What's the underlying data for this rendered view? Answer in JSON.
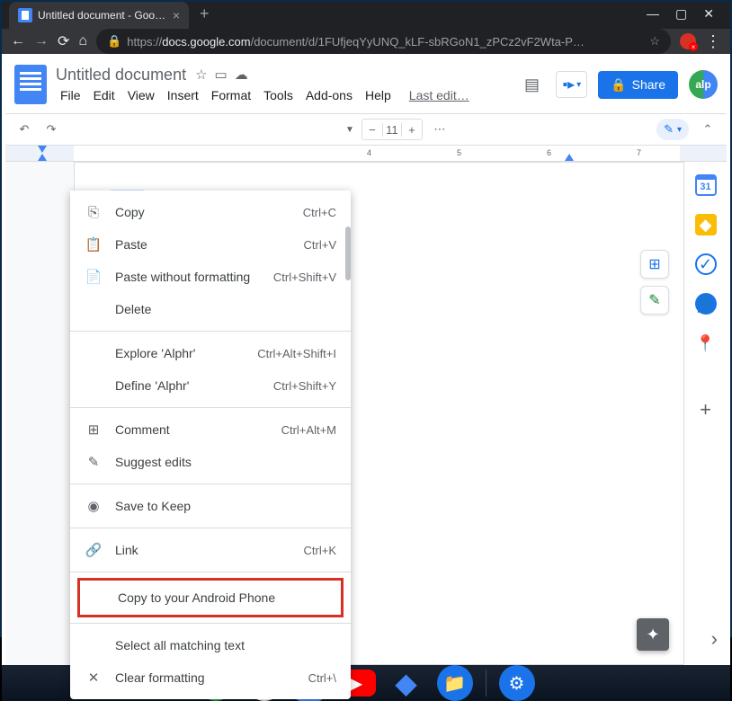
{
  "browser": {
    "tab_title": "Untitled document - Google Doc",
    "url_prefix": "https://",
    "url_domain": "docs.google.com",
    "url_path": "/document/d/1FUfjeqYyUNQ_kLF-sbRGoN1_zPCz2vF2Wta-P…"
  },
  "docs": {
    "title": "Untitled document",
    "menubar": [
      "File",
      "Edit",
      "View",
      "Insert",
      "Format",
      "Tools",
      "Add-ons",
      "Help"
    ],
    "last_edit": "Last edit…",
    "share_label": "Share",
    "avatar": "alp",
    "font_size": "11",
    "selected_text": "Alphr"
  },
  "ruler_ticks": [
    {
      "pos": 402,
      "label": "4"
    },
    {
      "pos": 502,
      "label": "5"
    },
    {
      "pos": 602,
      "label": "6"
    },
    {
      "pos": 702,
      "label": "7"
    }
  ],
  "context_menu": [
    {
      "type": "item",
      "icon": "⎘",
      "label": "Copy",
      "shortcut": "Ctrl+C"
    },
    {
      "type": "item",
      "icon": "📋",
      "label": "Paste",
      "shortcut": "Ctrl+V"
    },
    {
      "type": "item",
      "icon": "📄",
      "label": "Paste without formatting",
      "shortcut": "Ctrl+Shift+V"
    },
    {
      "type": "item",
      "icon": "",
      "label": "Delete",
      "shortcut": ""
    },
    {
      "type": "sep"
    },
    {
      "type": "item",
      "icon": "",
      "label": "Explore 'Alphr'",
      "shortcut": "Ctrl+Alt+Shift+I"
    },
    {
      "type": "item",
      "icon": "",
      "label": "Define 'Alphr'",
      "shortcut": "Ctrl+Shift+Y"
    },
    {
      "type": "sep"
    },
    {
      "type": "item",
      "icon": "⊞",
      "label": "Comment",
      "shortcut": "Ctrl+Alt+M"
    },
    {
      "type": "item",
      "icon": "✎",
      "label": "Suggest edits",
      "shortcut": ""
    },
    {
      "type": "sep"
    },
    {
      "type": "item",
      "icon": "◉",
      "label": "Save to Keep",
      "shortcut": ""
    },
    {
      "type": "sep"
    },
    {
      "type": "item",
      "icon": "🔗",
      "label": "Link",
      "shortcut": "Ctrl+K"
    },
    {
      "type": "sep"
    },
    {
      "type": "item",
      "icon": "",
      "label": "Copy to your Android Phone",
      "shortcut": "",
      "boxed": true
    },
    {
      "type": "sep"
    },
    {
      "type": "item",
      "icon": "",
      "label": "Select all matching text",
      "shortcut": ""
    },
    {
      "type": "item",
      "icon": "✕",
      "label": "Clear formatting",
      "shortcut": "Ctrl+\\"
    }
  ],
  "floating": {
    "add_comment": "⊞",
    "suggest": "✎"
  },
  "side_panel": [
    {
      "name": "calendar",
      "color": "#4285f4",
      "bg": "#e8f0fe",
      "glyph": "31"
    },
    {
      "name": "keep",
      "color": "#fff",
      "bg": "#fbbc04",
      "glyph": "◆"
    },
    {
      "name": "tasks",
      "color": "#1a73e8",
      "bg": "",
      "glyph": "✓"
    },
    {
      "name": "contacts",
      "color": "#fff",
      "bg": "#1a73e8",
      "glyph": "👤"
    },
    {
      "name": "maps",
      "color": "#ea4335",
      "bg": "",
      "glyph": "📍"
    },
    {
      "name": "add",
      "color": "#5f6368",
      "bg": "",
      "glyph": "+"
    }
  ]
}
